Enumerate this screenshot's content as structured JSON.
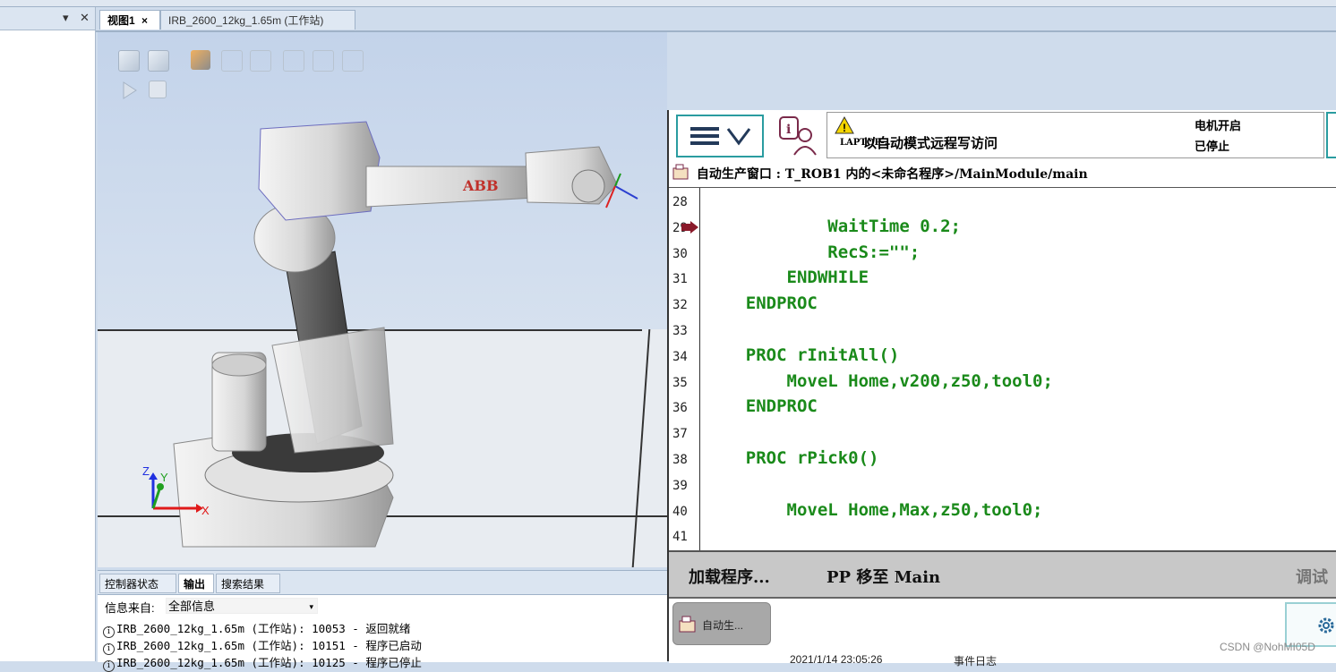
{
  "window": {
    "left_panel": {
      "dropdown_icon": "dropdown-arrow-icon",
      "close_icon": "close-icon"
    },
    "tabs": [
      {
        "label": "视图1",
        "close": "×",
        "active": true
      },
      {
        "label": "IRB_2600_12kg_1.65m (工作站)",
        "active": false
      }
    ]
  },
  "viewport": {
    "robot_brand": "ABB",
    "axes": {
      "z": "Z",
      "y": "Y",
      "x": "X"
    }
  },
  "output_panel": {
    "tabs": [
      {
        "label": "控制器状态",
        "active": false
      },
      {
        "label": "输出",
        "active": true
      },
      {
        "label": "搜索结果",
        "active": false
      }
    ],
    "filter_label": "信息来自:",
    "filter_value": "全部信息",
    "log": [
      "IRB_2600_12kg_1.65m (工作站): 10053 - 返回就绪",
      "IRB_2600_12kg_1.65m (工作站): 10151 - 程序已启动",
      "IRB_2600_12kg_1.65m (工作站): 10125 - 程序已停止"
    ]
  },
  "flexpendant": {
    "status": {
      "host": "LAPTOP-...",
      "message": "以自动模式远程写访问",
      "motor": "电机开启",
      "state": "已停止"
    },
    "path": "自动生产窗口 : T_ROB1 内的<未命名程序>/MainModule/main",
    "code_lines": [
      {
        "n": "28",
        "text": ""
      },
      {
        "n": "29",
        "text": "            WaitTime 0.2;"
      },
      {
        "n": "30",
        "text": "            RecS:=\"\";"
      },
      {
        "n": "31",
        "text": "        ENDWHILE"
      },
      {
        "n": "32",
        "text": "    ENDPROC"
      },
      {
        "n": "33",
        "text": ""
      },
      {
        "n": "34",
        "text": "    PROC rInitAll()"
      },
      {
        "n": "35",
        "text": "        MoveL Home,v200,z50,tool0;"
      },
      {
        "n": "36",
        "text": "    ENDPROC"
      },
      {
        "n": "37",
        "text": ""
      },
      {
        "n": "38",
        "text": "    PROC rPick0()"
      },
      {
        "n": "39",
        "text": ""
      },
      {
        "n": "40",
        "text": "        MoveL Home,Max,z50,tool0;"
      },
      {
        "n": "41",
        "text": ""
      }
    ],
    "program_pointer_line": "29",
    "toolbar": {
      "load": "加载程序...",
      "pp_main": "PP 移至 Main",
      "debug": "调试"
    },
    "task_button": "自动生...",
    "settings_icon": "gear-icon"
  },
  "bottom_status": {
    "datetime": "2021/1/14 23:05:26",
    "log_label": "事件日志"
  },
  "watermark": "CSDN @NohMI05D"
}
